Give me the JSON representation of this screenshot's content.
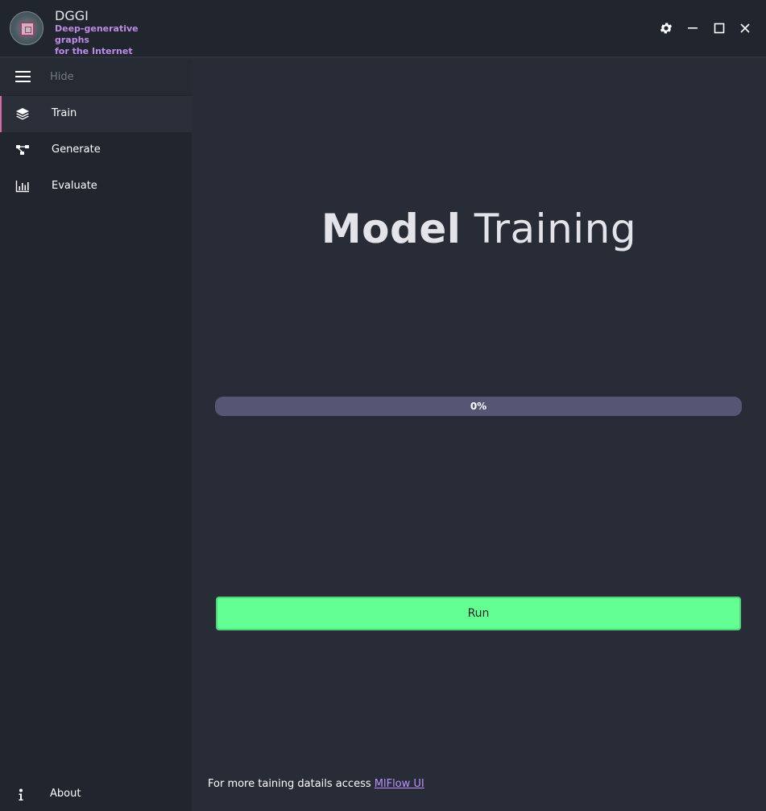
{
  "window": {
    "title": "DGGI",
    "subtitle_line1": "Deep-generative graphs",
    "subtitle_line2": "for the Internet"
  },
  "titlebar_icons": [
    "gear-icon",
    "minimize-icon",
    "maximize-icon",
    "close-icon"
  ],
  "sidebar": {
    "toggle_label": "Hide",
    "items": [
      {
        "label": "Train",
        "icon": "layers-icon",
        "active": true
      },
      {
        "label": "Generate",
        "icon": "graph-nodes-icon",
        "active": false
      },
      {
        "label": "Evaluate",
        "icon": "bar-chart-icon",
        "active": false
      }
    ],
    "about_label": "About"
  },
  "main": {
    "title_bold": "Model",
    "title_light": "Training",
    "progress_percent": 0,
    "progress_label": "0%",
    "run_label": "Run",
    "footer_text": "For more taining datails access",
    "footer_link": "MlFlow UI"
  },
  "colors": {
    "accent_purple": "#bd93f9",
    "accent_pink": "#d56ba3",
    "run_green": "#64ff93",
    "background": "#282c37",
    "sidebar": "#21252d",
    "progress_track": "#545674"
  }
}
